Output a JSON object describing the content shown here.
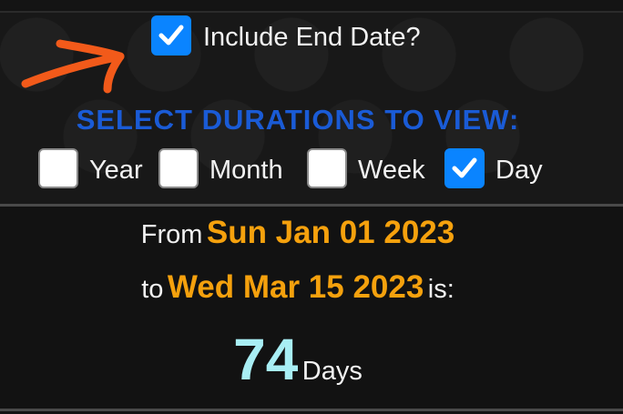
{
  "options": {
    "include_end_date": {
      "label": "Include End Date?",
      "checked": true
    },
    "durations_heading": "SELECT DURATIONS TO VIEW:",
    "durations": [
      {
        "label": "Year",
        "checked": false
      },
      {
        "label": "Month",
        "checked": false
      },
      {
        "label": "Week",
        "checked": false
      },
      {
        "label": "Day",
        "checked": true
      }
    ]
  },
  "annotation": {
    "icon": "arrow-annotation-icon",
    "color": "#f25a1a"
  },
  "result": {
    "from_label": "From",
    "start_date": "Sun Jan 01 2023",
    "to_label": "to",
    "end_date": "Wed Mar 15 2023",
    "is_label": "is:",
    "value": "74",
    "unit": "Days"
  },
  "colors": {
    "checkbox_checked": "#0a84ff",
    "heading_blue": "#1a5bd6",
    "date_orange": "#f5a10d",
    "number_cyan": "#a8eef4",
    "background": "#121212"
  }
}
